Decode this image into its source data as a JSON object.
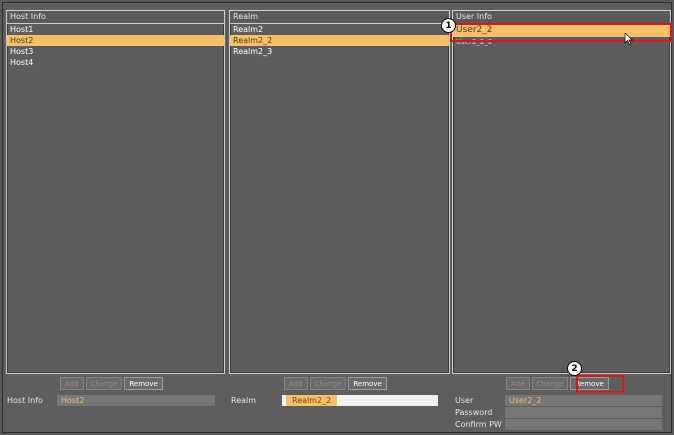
{
  "panels": {
    "host": {
      "header": "Host Info",
      "items": [
        "Host1",
        "Host2",
        "Host3",
        "Host4"
      ],
      "selected_index": 1
    },
    "realm": {
      "header": "Realm",
      "items": [
        "Realm2",
        "Realm2_2",
        "Realm2_3"
      ],
      "selected_index": 1
    },
    "user": {
      "header": "User Info",
      "items": [
        "User2_2",
        "User2_2_2"
      ],
      "selected_index": 0
    }
  },
  "buttons": {
    "add": "Add",
    "change": "Change",
    "remove": "Remove"
  },
  "form": {
    "host_label": "Host Info",
    "host_value": "Host2",
    "realm_label": "Realm",
    "realm_value": "Realm2_2",
    "user_label": "User",
    "user_value": "User2_2",
    "password_label": "Password",
    "password_value": "",
    "confirm_label": "Confirm PW",
    "confirm_value": ""
  },
  "callouts": {
    "one": "1",
    "two": "2"
  },
  "colors": {
    "selection": "#f8bf6b",
    "highlight_box": "#d8181b",
    "background": "#5d5d5d"
  }
}
